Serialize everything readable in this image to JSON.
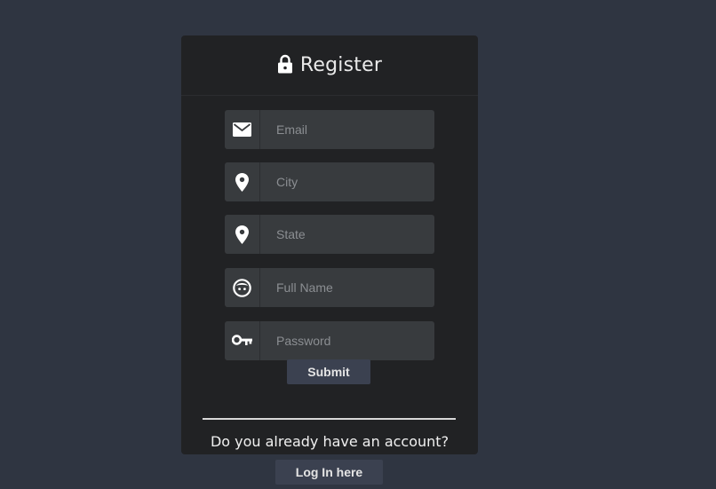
{
  "form": {
    "title": "Register",
    "title_icon": "lock-icon",
    "fields": [
      {
        "name": "email",
        "icon": "envelope-icon",
        "placeholder": "Email",
        "value": ""
      },
      {
        "name": "city",
        "icon": "map-pin-icon",
        "placeholder": "City",
        "value": ""
      },
      {
        "name": "state",
        "icon": "map-pin-icon",
        "placeholder": "State",
        "value": ""
      },
      {
        "name": "full-name",
        "icon": "face-icon",
        "placeholder": "Full Name",
        "value": ""
      },
      {
        "name": "password",
        "icon": "key-icon",
        "placeholder": "Password",
        "value": ""
      }
    ],
    "submit_label": "Submit",
    "account_prompt": "Do you already have an account?",
    "login_label": "Log In here"
  },
  "colors": {
    "background": "#2f3541",
    "card": "#212224",
    "field": "#383b3e",
    "button": "#3b4150",
    "text": "#e9e9e9"
  }
}
